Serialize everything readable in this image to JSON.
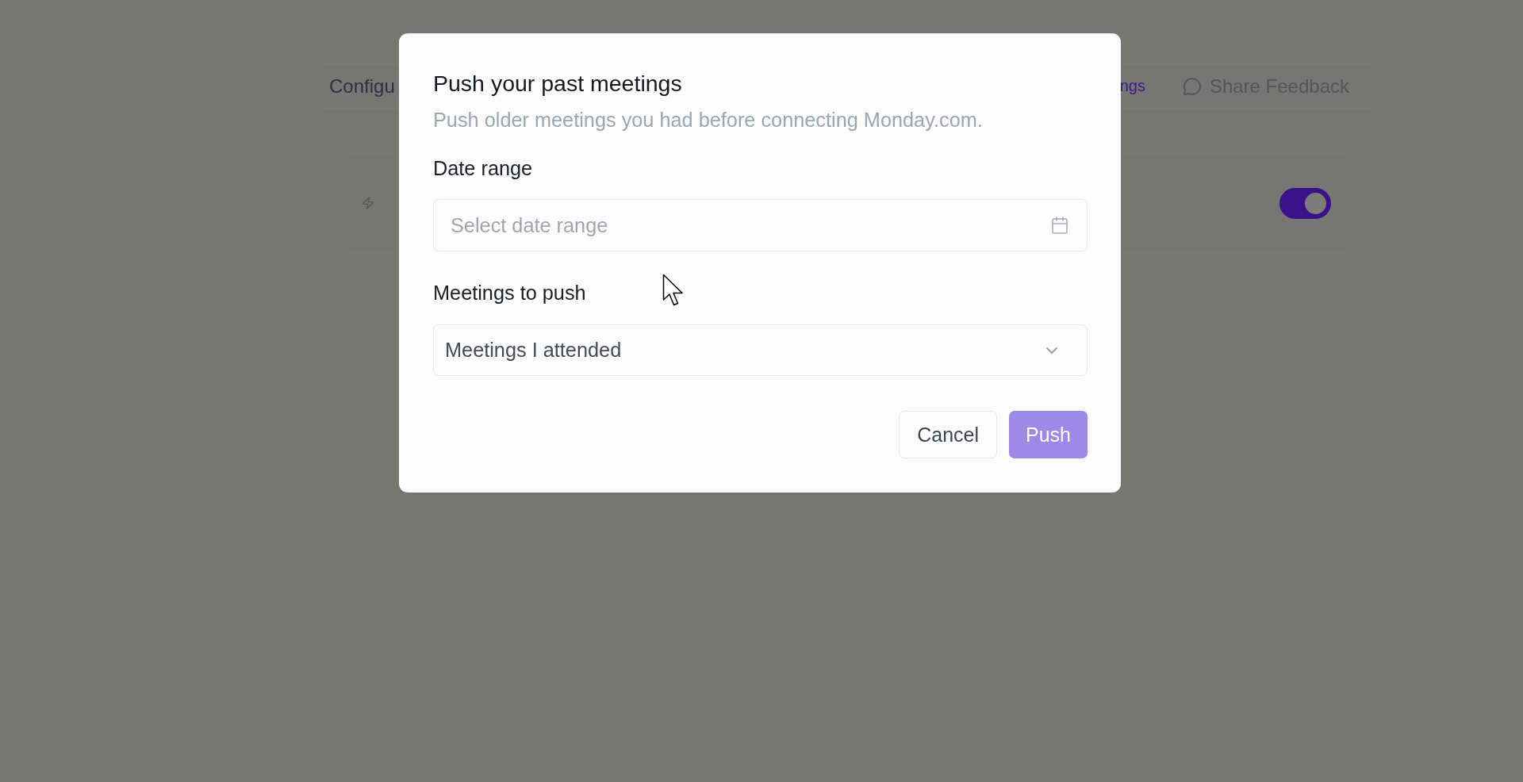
{
  "background": {
    "header": {
      "title": "Configu",
      "actions": [
        {
          "kind": "link",
          "label": "ngs"
        },
        {
          "kind": "feedback",
          "label": "Share Feedback"
        }
      ]
    },
    "settings_row": {
      "toggle": {
        "on": true
      }
    }
  },
  "dialog": {
    "title": "Push your past meetings",
    "description": "Push older meetings you had before connecting Monday.com.",
    "fields": [
      {
        "kind": "date",
        "label": "Date range",
        "placeholder": "Select date range"
      },
      {
        "kind": "select",
        "label": "Meetings to push",
        "value": "Meetings I attended"
      }
    ],
    "buttons": [
      {
        "kind": "secondary",
        "label": "Cancel",
        "disabled": false
      },
      {
        "kind": "primary",
        "label": "Push",
        "disabled": true
      }
    ]
  }
}
